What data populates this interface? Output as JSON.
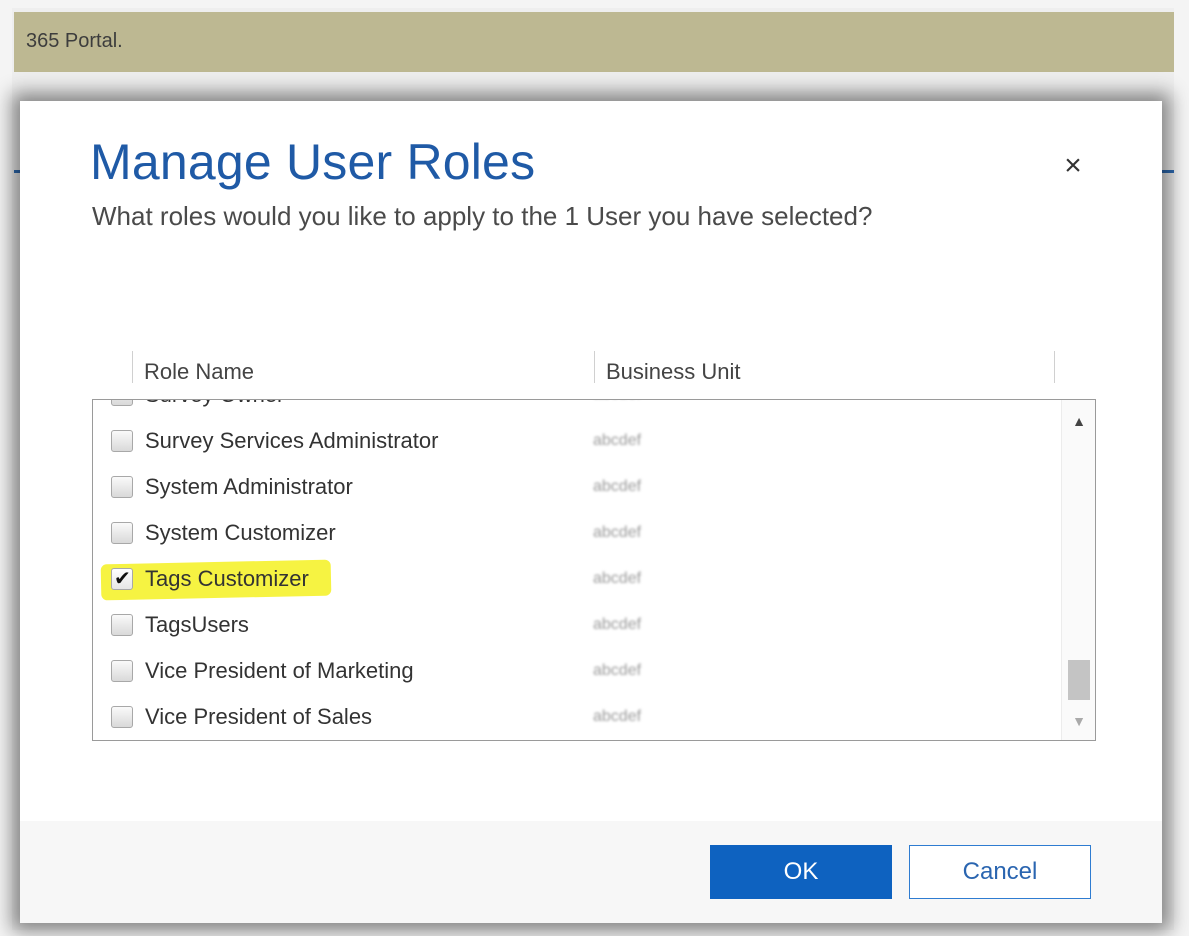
{
  "portal": {
    "title": "365 Portal."
  },
  "dialog": {
    "title": "Manage User Roles",
    "subtitle": "What roles would you like to apply to the 1 User you have selected?",
    "close_glyph": "×",
    "columns": {
      "role_name": "Role Name",
      "business_unit": "Business Unit"
    },
    "roles": [
      {
        "name": "Survey Owner",
        "business_unit": "abcdef",
        "checked": false,
        "partial": true
      },
      {
        "name": "Survey Services Administrator",
        "business_unit": "abcdef",
        "checked": false
      },
      {
        "name": "System Administrator",
        "business_unit": "abcdef",
        "checked": false
      },
      {
        "name": "System Customizer",
        "business_unit": "abcdef",
        "checked": false
      },
      {
        "name": "Tags Customizer",
        "business_unit": "abcdef",
        "checked": true,
        "highlighted": true
      },
      {
        "name": "TagsUsers",
        "business_unit": "abcdef",
        "checked": false
      },
      {
        "name": "Vice President of Marketing",
        "business_unit": "abcdef",
        "checked": false
      },
      {
        "name": "Vice President of Sales",
        "business_unit": "abcdef",
        "checked": false
      }
    ],
    "buttons": {
      "ok": "OK",
      "cancel": "Cancel"
    }
  },
  "icons": {
    "close": "close-icon",
    "scroll_up": "triangle-up-icon",
    "scroll_down": "triangle-down-icon",
    "checkmark": "checkmark-icon"
  },
  "colors": {
    "portal_bar": "#bdb892",
    "title": "#1f5aa6",
    "ok_button": "#0e62c0",
    "highlight": "#f5f22e"
  }
}
